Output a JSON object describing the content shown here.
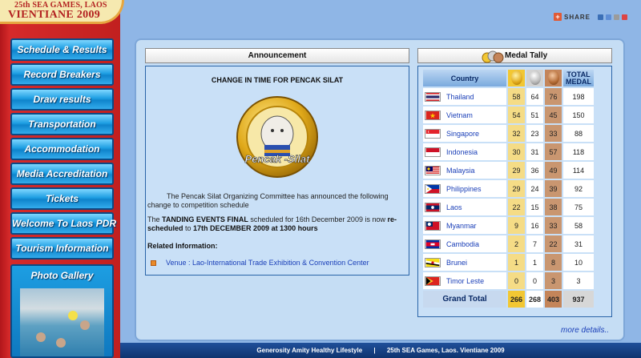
{
  "logo": {
    "line1": "25th SEA GAMES, LAOS",
    "line2": "VIENTIANE 2009"
  },
  "share": {
    "label": "SHARE"
  },
  "nav": {
    "items": [
      "Schedule & Results",
      "Record Breakers",
      "Draw results",
      "Transportation",
      "Accommodation",
      "Media Accreditation",
      "Tickets",
      "Welcome To Laos PDR",
      "Tourism Information"
    ],
    "gallery_title": "Photo Gallery"
  },
  "announcement": {
    "header": "Announcement",
    "title": "CHANGE IN TIME FOR PENCAK SILAT",
    "logo_text": "Pencak -Silat",
    "para1": "The Pencak Silat Organizing Committee has announced the following change to competition schedule",
    "para2_a": "The ",
    "para2_b": "TANDING EVENTS FINAL",
    "para2_c": " scheduled for 16th December 2009 is now ",
    "para2_d": "re-scheduled",
    "para2_e": " to ",
    "para2_f": "17th DECEMBER 2009 at 1300 hours",
    "related_label": "Related Information:",
    "related_link": "Venue : Lao-International Trade Exhibition & Convention Center"
  },
  "tally": {
    "header": "Medal Tally",
    "col_country": "Country",
    "col_total_1": "TOTAL",
    "col_total_2": "MEDAL",
    "rows": [
      {
        "country": "Thailand",
        "gold": "58",
        "silver": "64",
        "bronze": "76",
        "total": "198",
        "flag": "thailand"
      },
      {
        "country": "Vietnam",
        "gold": "54",
        "silver": "51",
        "bronze": "45",
        "total": "150",
        "flag": "vietnam"
      },
      {
        "country": "Singapore",
        "gold": "32",
        "silver": "23",
        "bronze": "33",
        "total": "88",
        "flag": "singapore"
      },
      {
        "country": "Indonesia",
        "gold": "30",
        "silver": "31",
        "bronze": "57",
        "total": "118",
        "flag": "indonesia"
      },
      {
        "country": "Malaysia",
        "gold": "29",
        "silver": "36",
        "bronze": "49",
        "total": "114",
        "flag": "malaysia"
      },
      {
        "country": "Philippines",
        "gold": "29",
        "silver": "24",
        "bronze": "39",
        "total": "92",
        "flag": "philippines"
      },
      {
        "country": "Laos",
        "gold": "22",
        "silver": "15",
        "bronze": "38",
        "total": "75",
        "flag": "laos"
      },
      {
        "country": "Myanmar",
        "gold": "9",
        "silver": "16",
        "bronze": "33",
        "total": "58",
        "flag": "myanmar"
      },
      {
        "country": "Cambodia",
        "gold": "2",
        "silver": "7",
        "bronze": "22",
        "total": "31",
        "flag": "cambodia"
      },
      {
        "country": "Brunei",
        "gold": "1",
        "silver": "1",
        "bronze": "8",
        "total": "10",
        "flag": "brunei"
      },
      {
        "country": "Timor Leste",
        "gold": "0",
        "silver": "0",
        "bronze": "3",
        "total": "3",
        "flag": "timor-leste"
      }
    ],
    "grand_total_label": "Grand Total",
    "grand_total": {
      "gold": "266",
      "silver": "268",
      "bronze": "403",
      "total": "937"
    },
    "more": "more details.."
  },
  "footer": {
    "left": "Generosity Amity Healthy Lifestyle",
    "sep": "|",
    "right": "25th SEA Games, Laos. Vientiane 2009"
  },
  "colors": {
    "nav_button": "#1d9ee2",
    "left_column": "#c1201f",
    "panel": "#c5ddf4",
    "gold": "#f2c733",
    "bronze": "#c4855a"
  }
}
